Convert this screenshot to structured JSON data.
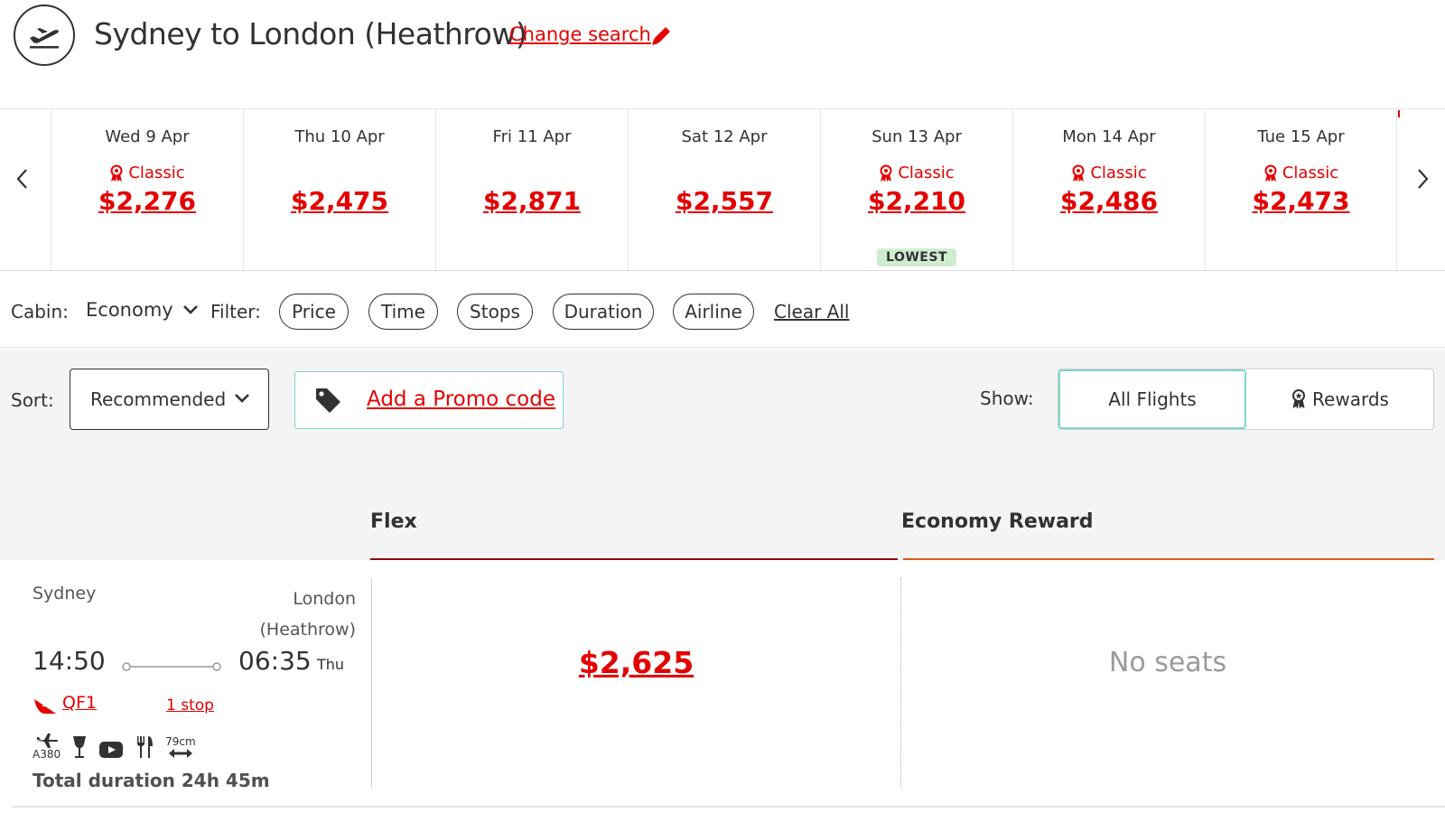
{
  "header": {
    "title": "Sydney to London (Heathrow)",
    "change_search": "Change search"
  },
  "dates": [
    {
      "label": "Wed 9 Apr",
      "classic": "Classic",
      "price": "$2,276",
      "badge": ""
    },
    {
      "label": "Thu 10 Apr",
      "classic": "",
      "price": "$2,475",
      "badge": ""
    },
    {
      "label": "Fri 11 Apr",
      "classic": "",
      "price": "$2,871",
      "badge": ""
    },
    {
      "label": "Sat 12 Apr",
      "classic": "",
      "price": "$2,557",
      "badge": ""
    },
    {
      "label": "Sun 13 Apr",
      "classic": "Classic",
      "price": "$2,210",
      "badge": "LOWEST"
    },
    {
      "label": "Mon 14 Apr",
      "classic": "Classic",
      "price": "$2,486",
      "badge": ""
    },
    {
      "label": "Tue 15 Apr",
      "classic": "Classic",
      "price": "$2,473",
      "badge": ""
    }
  ],
  "filters": {
    "cabin_label": "Cabin:",
    "cabin_value": "Economy",
    "filter_label": "Filter:",
    "pills": [
      "Price",
      "Time",
      "Stops",
      "Duration",
      "Airline"
    ],
    "clear_all": "Clear All"
  },
  "sort": {
    "label": "Sort:",
    "value": "Recommended",
    "promo": "Add a Promo code",
    "show_label": "Show:",
    "show_all": "All Flights",
    "show_rewards": "Rewards"
  },
  "columns": {
    "flex": "Flex",
    "reward": "Economy Reward"
  },
  "flight": {
    "origin": "Sydney",
    "destination": "London (Heathrow)",
    "depart": "14:50",
    "arrive": "06:35",
    "arrive_day": "Thu",
    "flight_number": "QF1",
    "stops": "1 stop",
    "aircraft": "A380",
    "seat_pitch": "79cm",
    "total_duration": "Total duration 24h 45m",
    "flex_price": "$2,625",
    "reward_status": "No seats"
  },
  "colors": {
    "brand_red": "#e40000",
    "flex_bar": "#8b0a0a",
    "reward_bar": "#d85a1a",
    "teal_accent": "#7fd3d0",
    "lowest_badge": "#cfeccf"
  }
}
